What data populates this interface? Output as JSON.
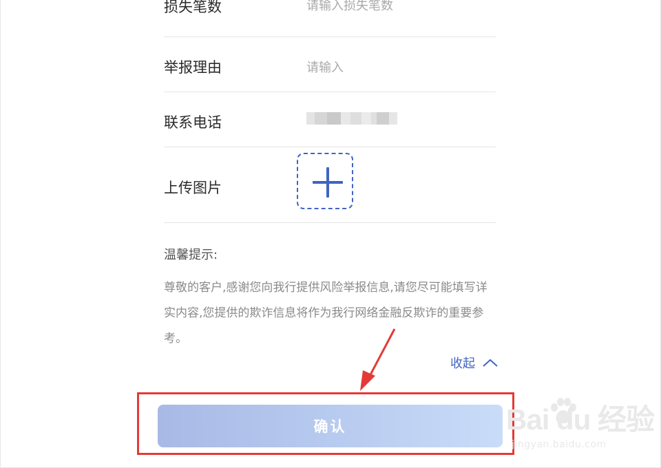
{
  "form": {
    "loss_count": {
      "label": "损失笔数",
      "placeholder": "请输入损失笔数"
    },
    "reason": {
      "label": "举报理由",
      "placeholder": "请输入"
    },
    "phone": {
      "label": "联系电话"
    },
    "upload": {
      "label": "上传图片",
      "icon": "plus-icon"
    }
  },
  "tips": {
    "title": "温馨提示:",
    "body": "尊敬的客户,感谢您向我行提供风险举报信息,请您尽可能填写详实内容,您提供的欺诈信息将作为我行网络金融反欺诈的重要参考。"
  },
  "collapse": {
    "label": "收起",
    "icon": "chevron-up-icon"
  },
  "confirm_button": {
    "label": "确认"
  },
  "watermark": {
    "brand": "Bai du 经验",
    "site": "jingyan.baidu.com"
  },
  "colors": {
    "accent": "#3f64c2",
    "highlight": "#e53935",
    "button_start": "#a9b9e6",
    "button_end": "#c9dcf8"
  }
}
